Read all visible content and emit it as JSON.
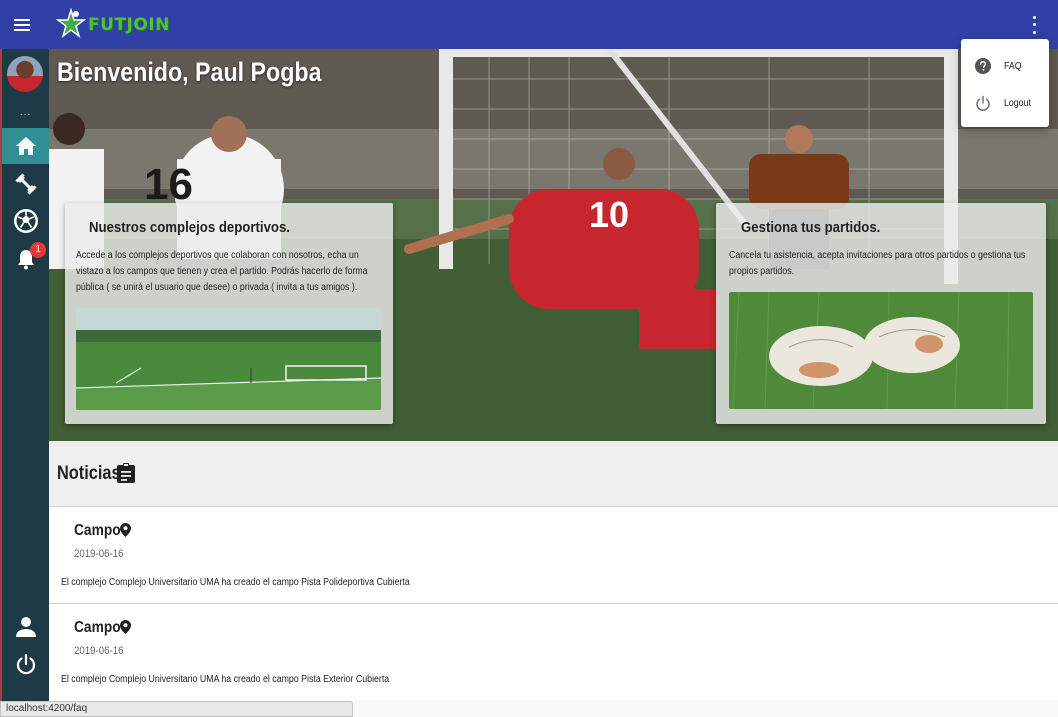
{
  "app": {
    "brand": "FUTJOIN",
    "brand_color": "#53c03c",
    "primary_color": "#3140a6",
    "sidebar_color": "#1d3a46",
    "accent_color": "#2f8f95"
  },
  "topbar": {
    "menu_icon": "menu-icon",
    "more_icon": "more-vert-icon"
  },
  "sidebar": {
    "avatar_dots": "...",
    "items": [
      {
        "name": "home",
        "icon": "home-icon",
        "active": true
      },
      {
        "name": "complejos",
        "icon": "fitness-icon",
        "active": false
      },
      {
        "name": "partidos",
        "icon": "soccer-ball-icon",
        "active": false
      },
      {
        "name": "notifications",
        "icon": "bell-icon",
        "active": false,
        "badge": "1"
      }
    ],
    "bottom": [
      {
        "name": "profile",
        "icon": "person-icon"
      },
      {
        "name": "power",
        "icon": "power-icon"
      }
    ]
  },
  "hero": {
    "title": "Bienvenido, Paul Pogba",
    "cards": [
      {
        "title": "Nuestros complejos deportivos.",
        "text": "Accede a los complejos deportivos que colaboran con nosotros, echa un vistazo a los campos que tienen y crea el partido. Podrás hacerlo de forma pública ( se unirá el usuario que desee) o privada ( invita a tus amigos ).",
        "image": "soccer-field-image"
      },
      {
        "title": "Gestiona tus partidos.",
        "text": "Cancela tu asistencia, acepta invitaciones para otros partidos o gestiona tus propios partidos.",
        "image": "soccer-balls-image"
      }
    ]
  },
  "news": {
    "title": "Noticias",
    "icon": "assignment-icon",
    "items": [
      {
        "title": "Campo",
        "date": "2019-06-16",
        "description": "El complejo Complejo Universitario UMA ha creado el campo Pista Polideportiva Cubierta"
      },
      {
        "title": "Campo",
        "date": "2019-06-16",
        "description": "El complejo Complejo Universitario UMA ha creado el campo Pista Exterior Cubierta"
      }
    ]
  },
  "dropdown": {
    "items": [
      {
        "label": "FAQ",
        "icon": "help-icon"
      },
      {
        "label": "Logout",
        "icon": "power-icon"
      }
    ]
  },
  "statusbar": {
    "url": "localhost:4200/faq"
  }
}
